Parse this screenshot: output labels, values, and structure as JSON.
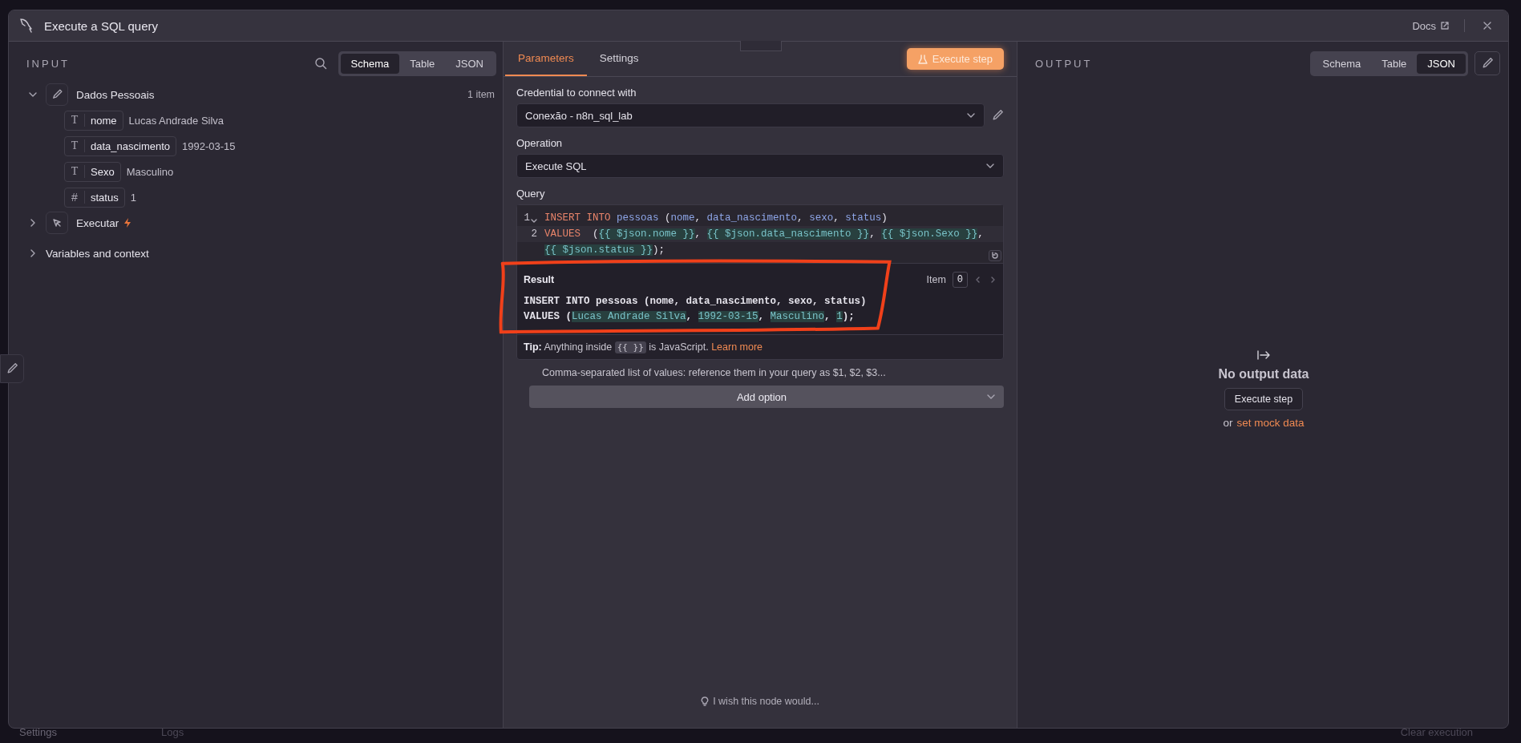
{
  "window": {
    "title": "Execute a SQL query",
    "docs_link": "Docs"
  },
  "background": {
    "left_label": "Settings",
    "logs_label": "Logs",
    "clear_label": "Clear execution"
  },
  "input_panel": {
    "heading": "INPUT",
    "view_tabs": [
      {
        "label": "Schema",
        "selected": true
      },
      {
        "label": "Table",
        "selected": false
      },
      {
        "label": "JSON",
        "selected": false
      }
    ],
    "nodes": [
      {
        "name": "Dados Pessoais",
        "expanded": true,
        "kind": "edit",
        "count": "1 item",
        "fields": [
          {
            "kind": "text",
            "type_glyph": "T",
            "key": "nome",
            "value": "Lucas Andrade Silva"
          },
          {
            "kind": "text",
            "type_glyph": "T",
            "key": "data_nascimento",
            "value": "1992-03-15"
          },
          {
            "kind": "text",
            "type_glyph": "T",
            "key": "Sexo",
            "value": "Masculino"
          },
          {
            "kind": "number",
            "type_glyph": "#",
            "key": "status",
            "value": "1"
          }
        ]
      },
      {
        "name": "Executar",
        "expanded": false,
        "kind": "trigger"
      }
    ],
    "variables": {
      "label": "Variables and context",
      "expanded": false
    }
  },
  "parameters_panel": {
    "tabs": [
      {
        "label": "Parameters",
        "selected": true
      },
      {
        "label": "Settings",
        "selected": false
      }
    ],
    "execute_button": "Execute step",
    "credential": {
      "label": "Credential to connect with",
      "value": "Conexão - n8n_sql_lab"
    },
    "operation": {
      "label": "Operation",
      "value": "Execute SQL"
    },
    "query": {
      "label": "Query",
      "lines": [
        {
          "number": "1",
          "foldable": true,
          "segments": [
            {
              "kind": "keyword",
              "text": "INSERT INTO"
            },
            {
              "kind": "ident",
              "text": "pessoas"
            },
            {
              "kind": "plain",
              "text": " ("
            },
            {
              "kind": "ident",
              "text": "nome"
            },
            {
              "kind": "plain",
              "text": ", "
            },
            {
              "kind": "ident",
              "text": "data_nascimento"
            },
            {
              "kind": "plain",
              "text": ", "
            },
            {
              "kind": "ident",
              "text": "sexo"
            },
            {
              "kind": "plain",
              "text": ", "
            },
            {
              "kind": "ident",
              "text": "status"
            },
            {
              "kind": "plain",
              "text": ")"
            }
          ]
        },
        {
          "number": "2",
          "foldable": false,
          "segments": [
            {
              "kind": "keyword",
              "text": "VALUES"
            },
            {
              "kind": "plain",
              "text": " ("
            },
            {
              "kind": "expr",
              "text": "{{ $json.nome }}"
            },
            {
              "kind": "plain",
              "text": ", "
            },
            {
              "kind": "expr",
              "text": "{{ $json.data_nascimento }}"
            },
            {
              "kind": "plain",
              "text": ", "
            },
            {
              "kind": "expr",
              "text": "{{ $json.Sexo }}"
            },
            {
              "kind": "plain",
              "text": ","
            }
          ]
        },
        {
          "foldable": false,
          "segments": [
            {
              "kind": "expr",
              "text": "{{ $json.status }}"
            },
            {
              "kind": "plain",
              "text": ");"
            }
          ]
        }
      ]
    },
    "result": {
      "label": "Result",
      "item_label": "Item",
      "item_value": "0",
      "lines": [
        [
          {
            "kind": "plain",
            "text": "INSERT INTO pessoas (nome, data_nascimento, sexo, status)"
          }
        ],
        [
          {
            "kind": "plain",
            "text": "VALUES ("
          },
          {
            "kind": "value",
            "text": "Lucas Andrade Silva"
          },
          {
            "kind": "plain",
            "text": ", "
          },
          {
            "kind": "value",
            "text": "1992-03-15"
          },
          {
            "kind": "plain",
            "text": ", "
          },
          {
            "kind": "value",
            "text": "Masculino"
          },
          {
            "kind": "plain",
            "text": ", "
          },
          {
            "kind": "value",
            "text": "1"
          },
          {
            "kind": "plain",
            "text": ");"
          }
        ]
      ]
    },
    "tip": {
      "label": "Tip:",
      "before": "Anything inside",
      "code": "{{ }}",
      "after": "is JavaScript.",
      "link": "Learn more"
    },
    "hint": "Comma-separated list of values: reference them in your query as $1, $2, $3...",
    "add_option": "Add option",
    "feedback": "I wish this node would..."
  },
  "output_panel": {
    "heading": "OUTPUT",
    "view_tabs": [
      {
        "label": "Schema",
        "selected": false
      },
      {
        "label": "Table",
        "selected": false
      },
      {
        "label": "JSON",
        "selected": true
      }
    ],
    "empty_title": "No output data",
    "execute_button": "Execute step",
    "or_text": "or",
    "mock_link": "set mock data"
  }
}
